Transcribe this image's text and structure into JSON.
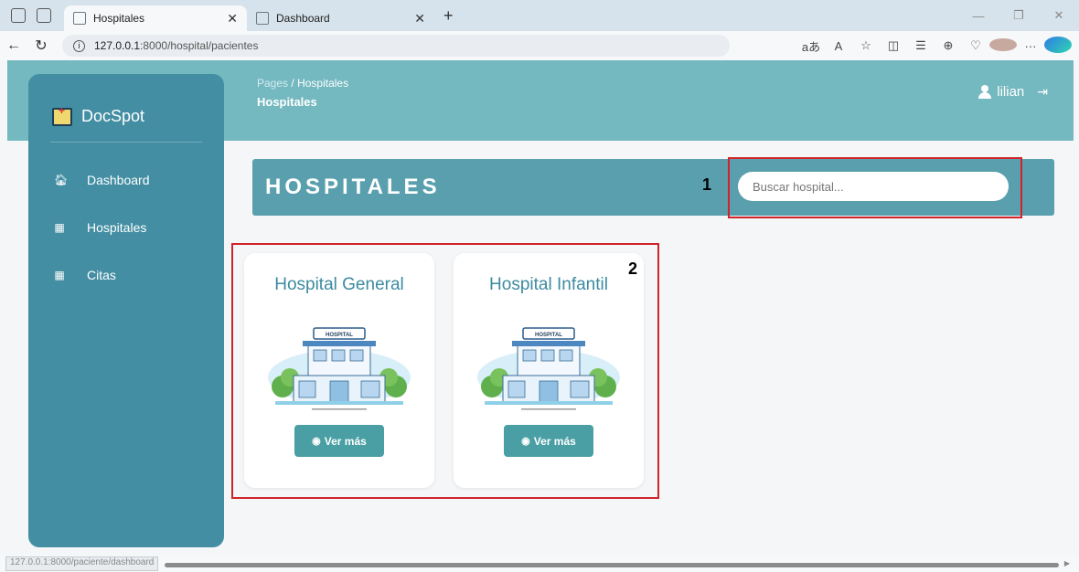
{
  "browser": {
    "tabs": [
      {
        "title": "Hospitales",
        "active": true
      },
      {
        "title": "Dashboard",
        "active": false
      }
    ],
    "url_host": "127.0.0.1",
    "url_rest": ":8000/hospital/pacientes",
    "status_url": "127.0.0.1:8000/paciente/dashboard"
  },
  "sidebar": {
    "brand": "DocSpot",
    "items": [
      {
        "label": "Dashboard",
        "icon": "home-icon"
      },
      {
        "label": "Hospitales",
        "icon": "building-icon"
      },
      {
        "label": "Citas",
        "icon": "building-icon"
      }
    ]
  },
  "header": {
    "breadcrumb_root": "Pages",
    "breadcrumb_sep": "/",
    "breadcrumb_current": "Hospitales",
    "page_title": "Hospitales",
    "username": "lilian"
  },
  "banner": {
    "title": "HOSPITALES",
    "search_placeholder": "Buscar hospital..."
  },
  "annotations": {
    "marker_1": "1",
    "marker_2": "2"
  },
  "hospitals": [
    {
      "name": "Hospital General",
      "button_label": "Ver más"
    },
    {
      "name": "Hospital Infantil",
      "button_label": "Ver más"
    }
  ],
  "colors": {
    "header": "#74b8c0",
    "sidebar": "#438ea3",
    "banner": "#5a9fae",
    "button": "#4a9fa4",
    "annotation_box": "#d0242a"
  }
}
